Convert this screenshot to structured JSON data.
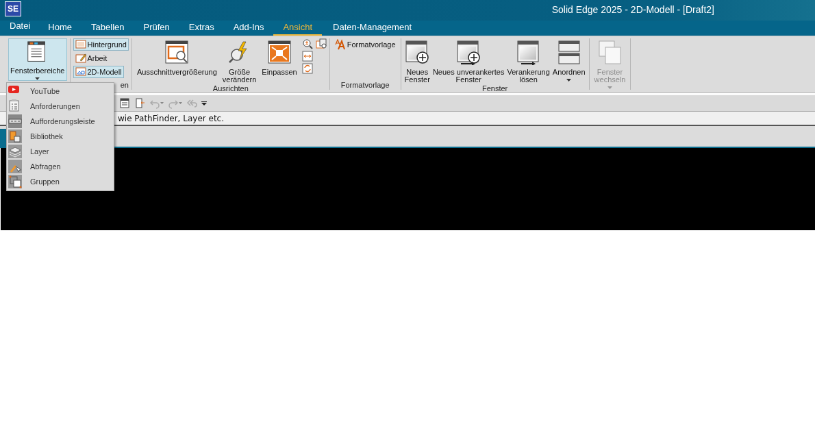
{
  "titlebar": {
    "logo": "SE",
    "title": "Solid Edge 2025 - 2D-Modell - [Draft2]"
  },
  "tabs": [
    {
      "label": "Datei",
      "kind": "file",
      "selected": false
    },
    {
      "label": "Home",
      "kind": "tab",
      "selected": false
    },
    {
      "label": "Tabellen",
      "kind": "tab",
      "selected": false
    },
    {
      "label": "Prüfen",
      "kind": "tab",
      "selected": false
    },
    {
      "label": "Extras",
      "kind": "tab",
      "selected": false
    },
    {
      "label": "Add-Ins",
      "kind": "tab",
      "selected": false
    },
    {
      "label": "Ansicht",
      "kind": "tab",
      "selected": true
    },
    {
      "label": "Daten-Management",
      "kind": "tab",
      "selected": false
    }
  ],
  "ribbon": {
    "groups": [
      {
        "buttons": [
          {
            "kind": "large",
            "label": "Fensterbereiche",
            "dropdown": true,
            "selected": true,
            "disabled": false
          }
        ]
      },
      {
        "label": "en",
        "buttons": [
          {
            "kind": "small",
            "label": "Hintergrund",
            "selected": true,
            "disabled": false
          },
          {
            "kind": "small",
            "label": "Arbeit",
            "selected": false,
            "disabled": false
          },
          {
            "kind": "small",
            "label": "2D-Modell",
            "selected": true,
            "disabled": false
          }
        ]
      },
      {
        "label": "Ausrichten",
        "buttons": [
          {
            "kind": "large",
            "label": "Ausschnittvergrößerung",
            "selected": false,
            "disabled": false
          },
          {
            "kind": "large",
            "label": "Größe\nverändern",
            "selected": false,
            "disabled": false
          },
          {
            "kind": "large",
            "label": "Einpassen",
            "selected": false,
            "disabled": false
          },
          {
            "kind": "iconstack"
          }
        ]
      },
      {
        "label": "Formatvorlage",
        "buttons": [
          {
            "kind": "small",
            "label": "Formatvorlage",
            "selected": false,
            "disabled": false
          }
        ]
      },
      {
        "label": "Fenster",
        "buttons": [
          {
            "kind": "large",
            "label": "Neues\nFenster",
            "selected": false,
            "disabled": false
          },
          {
            "kind": "large",
            "label": "Neues unverankertes\nFenster",
            "selected": false,
            "disabled": false
          },
          {
            "kind": "large",
            "label": "Verankerung\nlösen",
            "selected": false,
            "disabled": false
          },
          {
            "kind": "large",
            "label": "Anordnen",
            "dropdown": true,
            "selected": false,
            "disabled": false
          }
        ]
      },
      {
        "buttons": [
          {
            "kind": "large",
            "label": "Fenster\nwechseln",
            "dropdown": true,
            "selected": false,
            "disabled": true
          }
        ]
      }
    ]
  },
  "prompt": "wie PathFinder, Layer etc.",
  "menu": {
    "items": [
      {
        "label": "YouTube"
      },
      {
        "label": "Anforderungen"
      },
      {
        "label": "Aufforderungsleiste"
      },
      {
        "label": "Bibliothek"
      },
      {
        "label": "Layer"
      },
      {
        "label": "Abfragen"
      },
      {
        "label": "Gruppen"
      }
    ]
  }
}
